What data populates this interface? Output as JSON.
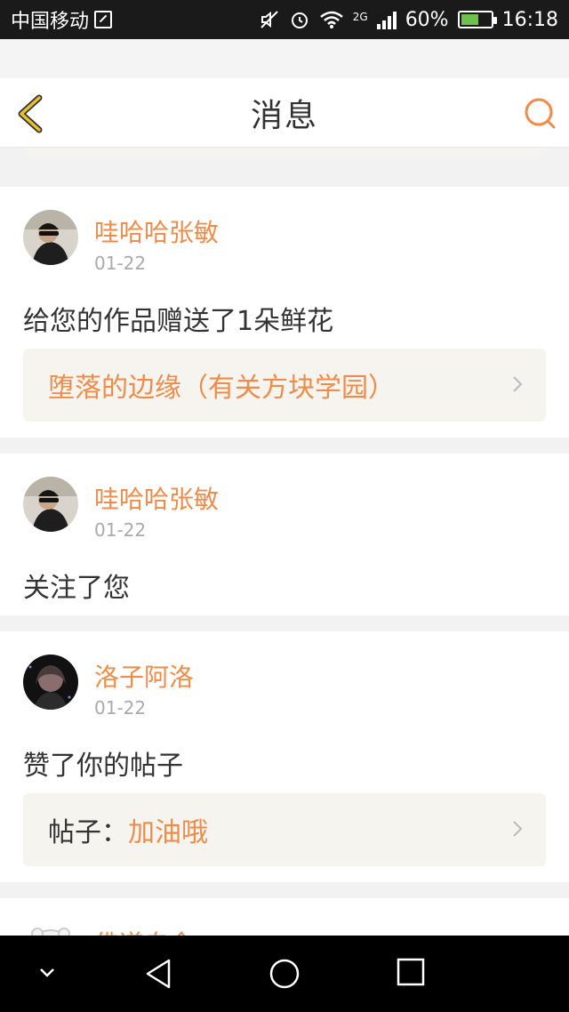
{
  "status": {
    "carrier": "中国移动",
    "network": "2G",
    "battery": "60%",
    "battery_level": 0.6,
    "time": "16:18"
  },
  "header": {
    "title": "消息"
  },
  "messages": [
    {
      "username": "哇哈哈张敏",
      "date": "01-22",
      "action": "给您的作品赠送了1朵鲜花",
      "ref_prefix": "",
      "ref_title": "堕落的边缘（有关方块学园）"
    },
    {
      "username": "哇哈哈张敏",
      "date": "01-22",
      "action": "关注了您"
    },
    {
      "username": "洛子阿洛",
      "date": "01-22",
      "action": "赞了你的帖子",
      "ref_prefix": "帖子：",
      "ref_title": "加油哦"
    },
    {
      "username": "佛道自命"
    }
  ],
  "colors": {
    "accent": "#f08c4a",
    "back_icon": "#e8c12a",
    "ref_bg": "#f6f4ee"
  }
}
